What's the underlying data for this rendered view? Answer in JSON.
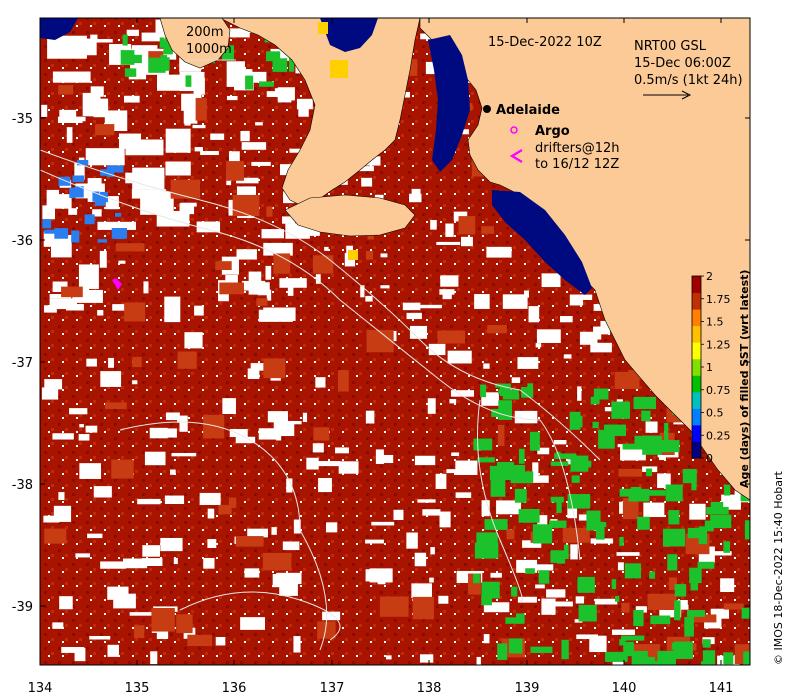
{
  "map": {
    "date_label": "15-Dec-2022 10Z",
    "legend_depth": {
      "line1": "200m",
      "line2": "1000m"
    },
    "current_legend": {
      "line1": "NRT00 GSL",
      "line2": "15-Dec 06:00Z",
      "line3": "0.5m/s (1kt 24h)"
    },
    "city": {
      "name": "Adelaide",
      "lon": 138.6,
      "lat": -34.93
    },
    "argo_label": "Argo",
    "drifters_label": {
      "line1": "drifters@12h",
      "line2": "to 16/12 12Z"
    },
    "credit": "© IMOS 18-Dec-2022 15:40 Hobart"
  },
  "axes": {
    "x_ticks": [
      "134",
      "135",
      "136",
      "137",
      "138",
      "139",
      "140",
      "141"
    ],
    "y_ticks": [
      "-35",
      "-36",
      "-37",
      "-38",
      "-39"
    ]
  },
  "colorbar": {
    "title": "Age (days) of filled SST (wrt latest)",
    "ticks": [
      "0",
      "0.25",
      "0.5",
      "0.75",
      "1",
      "1.25",
      "1.5",
      "1.75",
      "2"
    ],
    "range": [
      0,
      2
    ],
    "colors": [
      "#000080",
      "#0000ff",
      "#0080ff",
      "#00c0c0",
      "#00c000",
      "#80e000",
      "#ffff00",
      "#ffc000",
      "#ff8000",
      "#c03000",
      "#a00000"
    ]
  },
  "colors": {
    "land": "#fcca96",
    "sst_old": "#b01800",
    "sst_mid": "#c83c14",
    "fresh": "#1cc22c",
    "deep_blue": "#000a80",
    "no_data": "#ffffff",
    "argo": "#ff00ff"
  }
}
